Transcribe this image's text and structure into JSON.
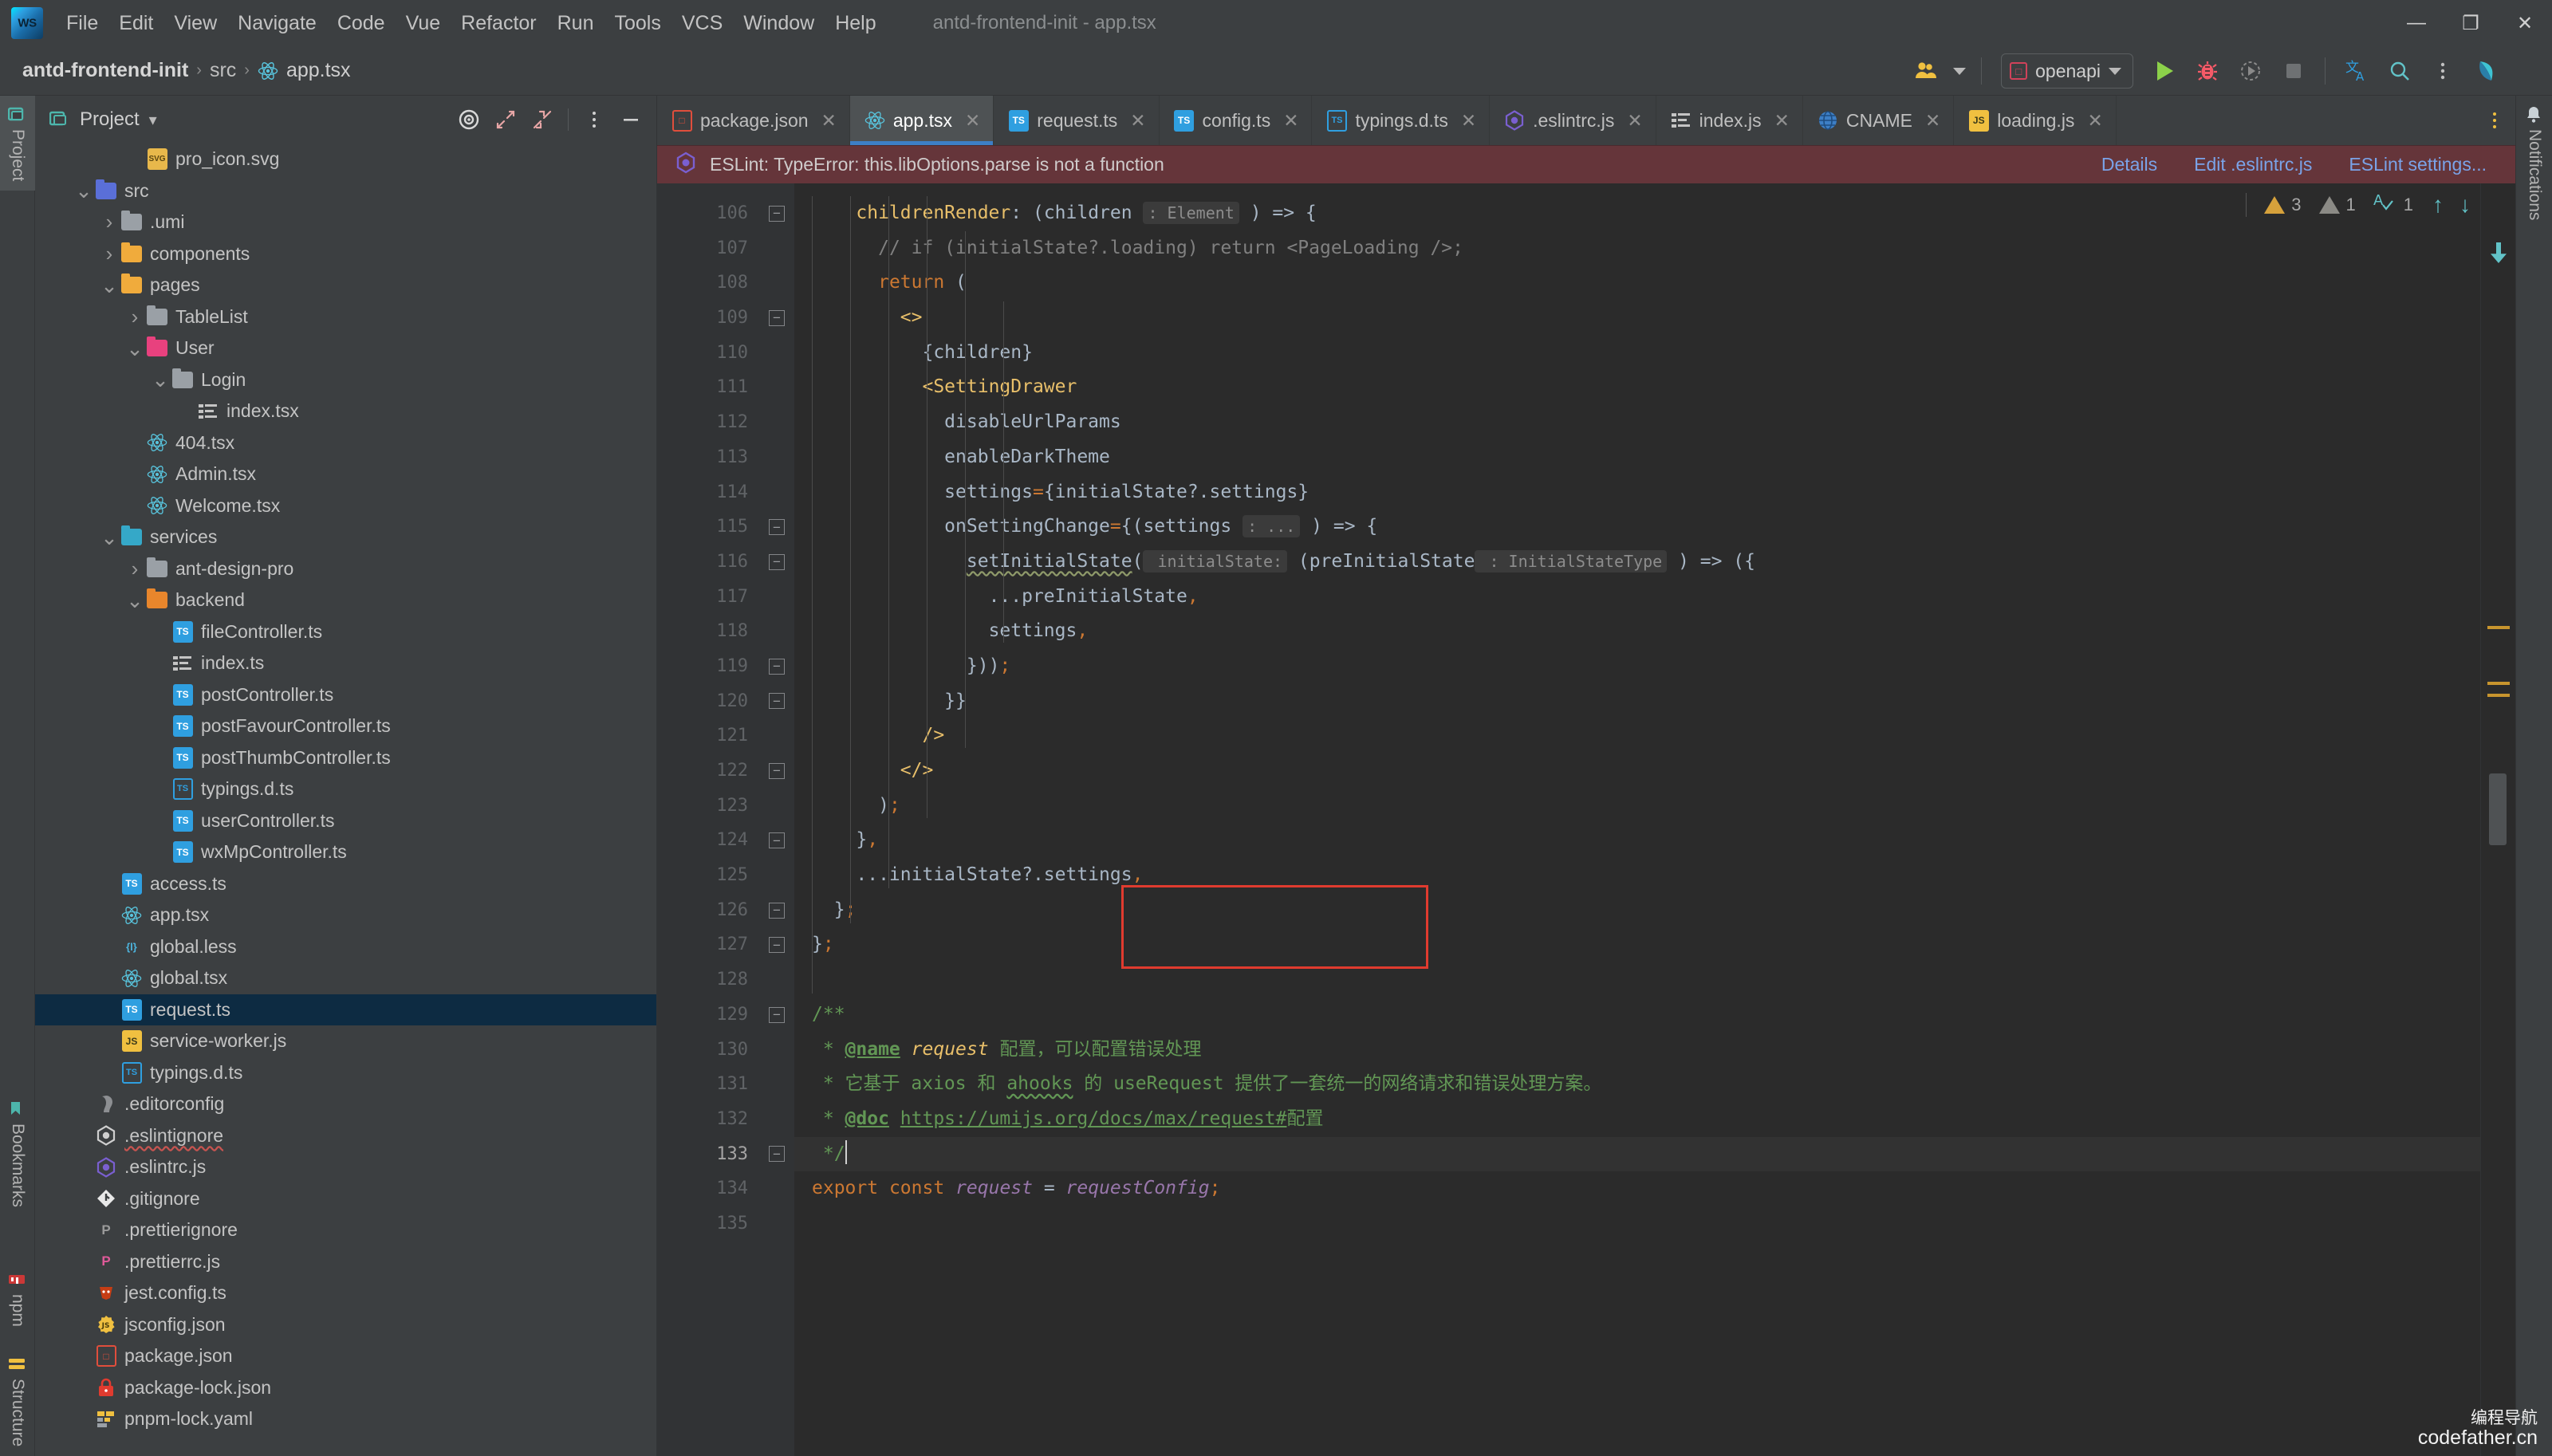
{
  "window": {
    "title": "antd-frontend-init - app.tsx",
    "controls": {
      "minimize": "—",
      "maximize": "❐",
      "close": "✕"
    }
  },
  "menubar": {
    "logo_text": "WS",
    "items": [
      "File",
      "Edit",
      "View",
      "Navigate",
      "Code",
      "Vue",
      "Refactor",
      "Run",
      "Tools",
      "VCS",
      "Window",
      "Help"
    ]
  },
  "navbar": {
    "breadcrumb": {
      "root": "antd-frontend-init",
      "sep": "›",
      "segments": [
        "src"
      ],
      "file": "app.tsx"
    },
    "run_config": {
      "label": "openapi",
      "icon": "module-icon"
    },
    "actions": [
      {
        "name": "collaborate-icon",
        "glyph": "👥"
      },
      {
        "name": "run-icon",
        "glyph": "▶"
      },
      {
        "name": "debug-icon",
        "glyph": "🐞"
      },
      {
        "name": "run-with-coverage-icon",
        "glyph": "◔"
      },
      {
        "name": "stop-icon",
        "glyph": "■"
      },
      {
        "name": "translate-icon",
        "glyph": "文A"
      },
      {
        "name": "search-everywhere-icon",
        "glyph": "🔍"
      },
      {
        "name": "more-options-icon",
        "glyph": "⋮"
      },
      {
        "name": "ide-assistant-icon",
        "glyph": "◗"
      }
    ]
  },
  "left_strip": {
    "tools": [
      {
        "label": "Project",
        "icon": "project-icon",
        "active": true
      },
      {
        "label": "Bookmarks",
        "icon": "bookmarks-icon",
        "active": false
      },
      {
        "label": "npm",
        "icon": "npm-icon",
        "active": false
      },
      {
        "label": "Structure",
        "icon": "structure-icon",
        "active": false
      }
    ]
  },
  "right_strip": {
    "tools": [
      {
        "label": "Notifications",
        "icon": "bell-icon"
      }
    ]
  },
  "project_panel": {
    "title": "Project",
    "title_icon": "project-folder-icon",
    "header_actions": [
      {
        "name": "scroll-from-source-icon",
        "glyph": "◎"
      },
      {
        "name": "expand-all-icon",
        "glyph": "⤡"
      },
      {
        "name": "collapse-all-icon",
        "glyph": "⤢"
      },
      {
        "name": "options-menu-icon",
        "glyph": "⋮"
      },
      {
        "name": "hide-panel-icon",
        "glyph": "—"
      }
    ],
    "tree": [
      {
        "label": "pro_icon.svg",
        "indent": 3,
        "tw": "",
        "icon": "svg",
        "selected": false
      },
      {
        "label": "src",
        "indent": 1,
        "tw": "v",
        "icon": "f-blue",
        "selected": false
      },
      {
        "label": ".umi",
        "indent": 2,
        "tw": ">",
        "icon": "f-grey",
        "selected": false
      },
      {
        "label": "components",
        "indent": 2,
        "tw": ">",
        "icon": "f-yellow",
        "selected": false
      },
      {
        "label": "pages",
        "indent": 2,
        "tw": "v",
        "icon": "f-yellow",
        "selected": false
      },
      {
        "label": "TableList",
        "indent": 3,
        "tw": ">",
        "icon": "f-grey",
        "selected": false
      },
      {
        "label": "User",
        "indent": 3,
        "tw": "v",
        "icon": "f-pink",
        "selected": false
      },
      {
        "label": "Login",
        "indent": 4,
        "tw": "v",
        "icon": "f-grey",
        "selected": false
      },
      {
        "label": "index.tsx",
        "indent": 5,
        "tw": "",
        "icon": "list",
        "selected": false
      },
      {
        "label": "404.tsx",
        "indent": 3,
        "tw": "",
        "icon": "react",
        "selected": false
      },
      {
        "label": "Admin.tsx",
        "indent": 3,
        "tw": "",
        "icon": "react",
        "selected": false
      },
      {
        "label": "Welcome.tsx",
        "indent": 3,
        "tw": "",
        "icon": "react",
        "selected": false
      },
      {
        "label": "services",
        "indent": 2,
        "tw": "v",
        "icon": "f-cyan",
        "selected": false
      },
      {
        "label": "ant-design-pro",
        "indent": 3,
        "tw": ">",
        "icon": "f-grey",
        "selected": false
      },
      {
        "label": "backend",
        "indent": 3,
        "tw": "v",
        "icon": "f-orange",
        "selected": false
      },
      {
        "label": "fileController.ts",
        "indent": 4,
        "tw": "",
        "icon": "ts",
        "selected": false
      },
      {
        "label": "index.ts",
        "indent": 4,
        "tw": "",
        "icon": "list",
        "selected": false
      },
      {
        "label": "postController.ts",
        "indent": 4,
        "tw": "",
        "icon": "ts",
        "selected": false
      },
      {
        "label": "postFavourController.ts",
        "indent": 4,
        "tw": "",
        "icon": "ts",
        "selected": false
      },
      {
        "label": "postThumbController.ts",
        "indent": 4,
        "tw": "",
        "icon": "ts",
        "selected": false
      },
      {
        "label": "typings.d.ts",
        "indent": 4,
        "tw": "",
        "icon": "tsout",
        "selected": false
      },
      {
        "label": "userController.ts",
        "indent": 4,
        "tw": "",
        "icon": "ts",
        "selected": false
      },
      {
        "label": "wxMpController.ts",
        "indent": 4,
        "tw": "",
        "icon": "ts",
        "selected": false
      },
      {
        "label": "access.ts",
        "indent": 2,
        "tw": "",
        "icon": "ts",
        "selected": false
      },
      {
        "label": "app.tsx",
        "indent": 2,
        "tw": "",
        "icon": "react",
        "selected": false
      },
      {
        "label": "global.less",
        "indent": 2,
        "tw": "",
        "icon": "less",
        "selected": false
      },
      {
        "label": "global.tsx",
        "indent": 2,
        "tw": "",
        "icon": "react",
        "selected": false
      },
      {
        "label": "request.ts",
        "indent": 2,
        "tw": "",
        "icon": "ts",
        "selected": true
      },
      {
        "label": "service-worker.js",
        "indent": 2,
        "tw": "",
        "icon": "js",
        "selected": false
      },
      {
        "label": "typings.d.ts",
        "indent": 2,
        "tw": "",
        "icon": "tsout",
        "selected": false
      },
      {
        "label": ".editorconfig",
        "indent": 1,
        "tw": "",
        "icon": "editorcfg",
        "selected": false
      },
      {
        "label": ".eslintignore",
        "indent": 1,
        "tw": "",
        "icon": "eslint-g",
        "selected": false,
        "wavy": true
      },
      {
        "label": ".eslintrc.js",
        "indent": 1,
        "tw": "",
        "icon": "eslint-p",
        "selected": false
      },
      {
        "label": ".gitignore",
        "indent": 1,
        "tw": "",
        "icon": "git",
        "selected": false
      },
      {
        "label": ".prettierignore",
        "indent": 1,
        "tw": "",
        "icon": "prett-g",
        "selected": false
      },
      {
        "label": ".prettierrc.js",
        "indent": 1,
        "tw": "",
        "icon": "prett-p",
        "selected": false
      },
      {
        "label": "jest.config.ts",
        "indent": 1,
        "tw": "",
        "icon": "jest",
        "selected": false
      },
      {
        "label": "jsconfig.json",
        "indent": 1,
        "tw": "",
        "icon": "jsgear",
        "selected": false
      },
      {
        "label": "package.json",
        "indent": 1,
        "tw": "",
        "icon": "json",
        "selected": false
      },
      {
        "label": "package-lock.json",
        "indent": 1,
        "tw": "",
        "icon": "lock",
        "selected": false
      },
      {
        "label": "pnpm-lock.yaml",
        "indent": 1,
        "tw": "",
        "icon": "yaml",
        "selected": false
      }
    ]
  },
  "editor": {
    "tabs": [
      {
        "label": "package.json",
        "icon": "json",
        "active": false
      },
      {
        "label": "app.tsx",
        "icon": "react",
        "active": true
      },
      {
        "label": "request.ts",
        "icon": "ts",
        "active": false
      },
      {
        "label": "config.ts",
        "icon": "ts",
        "active": false
      },
      {
        "label": "typings.d.ts",
        "icon": "tsout",
        "active": false
      },
      {
        "label": ".eslintrc.js",
        "icon": "eslint",
        "active": false
      },
      {
        "label": "index.js",
        "icon": "list",
        "active": false
      },
      {
        "label": "CNAME",
        "icon": "globe",
        "active": false
      },
      {
        "label": "loading.js",
        "icon": "js",
        "active": false
      }
    ],
    "tabs_more_icon": "tabs-more-icon",
    "eslint_banner": {
      "icon": "eslint-icon",
      "message": "ESLint: TypeError: this.libOptions.parse is not a function",
      "links": [
        "Details",
        "Edit .eslintrc.js",
        "ESLint settings..."
      ]
    },
    "inspections": {
      "warning_count": "3",
      "weak_warning_count": "1",
      "typo_count": "1",
      "prev_icon": "arrow-up-icon",
      "next_icon": "arrow-down-icon"
    },
    "first_line_number": 106,
    "lines": [
      {
        "n": 106,
        "fold": "minus",
        "indent": 2,
        "tokens": [
          {
            "t": "childrenRender",
            "c": "c-attr"
          },
          {
            "t": ": ",
            "c": "c-default"
          },
          {
            "t": "(",
            "c": "c-default"
          },
          {
            "t": "children",
            "c": "c-default"
          },
          {
            "t": " ",
            "c": "c-default"
          },
          {
            "t": ": Element",
            "c": "c-hint"
          },
          {
            "t": " ) => {",
            "c": "c-default"
          }
        ]
      },
      {
        "n": 107,
        "fold": "",
        "indent": 3,
        "tokens": [
          {
            "t": "// if (initialState?.loading) return <PageLoading />;",
            "c": "c-comment"
          }
        ]
      },
      {
        "n": 108,
        "fold": "",
        "indent": 3,
        "tokens": [
          {
            "t": "return",
            "c": "c-keyword"
          },
          {
            "t": " (",
            "c": "c-default"
          }
        ]
      },
      {
        "n": 109,
        "fold": "minus",
        "indent": 4,
        "tokens": [
          {
            "t": "<>",
            "c": "c-tag"
          }
        ]
      },
      {
        "n": 110,
        "fold": "",
        "indent": 5,
        "tokens": [
          {
            "t": "{children}",
            "c": "c-default"
          }
        ]
      },
      {
        "n": 111,
        "fold": "",
        "indent": 5,
        "tokens": [
          {
            "t": "<SettingDrawer",
            "c": "c-tag"
          }
        ]
      },
      {
        "n": 112,
        "fold": "",
        "indent": 6,
        "tokens": [
          {
            "t": "disableUrlParams",
            "c": "c-default"
          }
        ]
      },
      {
        "n": 113,
        "fold": "",
        "indent": 6,
        "tokens": [
          {
            "t": "enableDarkTheme",
            "c": "c-default"
          }
        ]
      },
      {
        "n": 114,
        "fold": "",
        "indent": 6,
        "tokens": [
          {
            "t": "settings",
            "c": "c-default"
          },
          {
            "t": "=",
            "c": "c-punct"
          },
          {
            "t": "{initialState?.settings}",
            "c": "c-default"
          }
        ]
      },
      {
        "n": 115,
        "fold": "minus",
        "indent": 6,
        "tokens": [
          {
            "t": "onSettingChange",
            "c": "c-default"
          },
          {
            "t": "=",
            "c": "c-punct"
          },
          {
            "t": "{(settings",
            "c": "c-default"
          },
          {
            "t": " ",
            "c": "c-default"
          },
          {
            "t": ": ...",
            "c": "c-hint"
          },
          {
            "t": " ) => {",
            "c": "c-default"
          }
        ]
      },
      {
        "n": 116,
        "fold": "minus",
        "indent": 7,
        "tokens": [
          {
            "t": "setInitialState",
            "c": "c-default wavy-gray"
          },
          {
            "t": "(",
            "c": "c-default"
          },
          {
            "t": " initialState:",
            "c": "c-hint"
          },
          {
            "t": " (preInitialState",
            "c": "c-default"
          },
          {
            "t": " : InitialStateType",
            "c": "c-hint"
          },
          {
            "t": " ) => ({",
            "c": "c-default"
          }
        ]
      },
      {
        "n": 117,
        "fold": "",
        "indent": 8,
        "tokens": [
          {
            "t": "...preInitialState",
            "c": "c-default"
          },
          {
            "t": ",",
            "c": "c-punct"
          }
        ]
      },
      {
        "n": 118,
        "fold": "",
        "indent": 8,
        "tokens": [
          {
            "t": "settings",
            "c": "c-default"
          },
          {
            "t": ",",
            "c": "c-punct"
          }
        ]
      },
      {
        "n": 119,
        "fold": "plus",
        "indent": 7,
        "tokens": [
          {
            "t": "}))",
            "c": "c-default"
          },
          {
            "t": ";",
            "c": "c-punct"
          }
        ]
      },
      {
        "n": 120,
        "fold": "plus",
        "indent": 6,
        "tokens": [
          {
            "t": "}}",
            "c": "c-default"
          }
        ]
      },
      {
        "n": 121,
        "fold": "",
        "indent": 5,
        "tokens": [
          {
            "t": "/>",
            "c": "c-tag"
          }
        ]
      },
      {
        "n": 122,
        "fold": "plus",
        "indent": 4,
        "tokens": [
          {
            "t": "</>",
            "c": "c-tag"
          }
        ]
      },
      {
        "n": 123,
        "fold": "",
        "indent": 3,
        "tokens": [
          {
            "t": ")",
            "c": "c-default"
          },
          {
            "t": ";",
            "c": "c-punct"
          }
        ]
      },
      {
        "n": 124,
        "fold": "plus",
        "indent": 2,
        "tokens": [
          {
            "t": "}",
            "c": "c-default"
          },
          {
            "t": ",",
            "c": "c-punct"
          }
        ]
      },
      {
        "n": 125,
        "fold": "",
        "indent": 2,
        "tokens": [
          {
            "t": "...initialState?.settings",
            "c": "c-default"
          },
          {
            "t": ",",
            "c": "c-punct"
          }
        ]
      },
      {
        "n": 126,
        "fold": "plus",
        "indent": 1,
        "tokens": [
          {
            "t": "}",
            "c": "c-default"
          },
          {
            "t": ";",
            "c": "c-punct"
          }
        ]
      },
      {
        "n": 127,
        "fold": "plus",
        "indent": 0,
        "tokens": [
          {
            "t": "}",
            "c": "c-default"
          },
          {
            "t": ";",
            "c": "c-punct"
          }
        ]
      },
      {
        "n": 128,
        "fold": "",
        "indent": 0,
        "tokens": []
      },
      {
        "n": 129,
        "fold": "minus",
        "indent": 0,
        "tokens": [
          {
            "t": "/**",
            "c": "c-doc"
          }
        ]
      },
      {
        "n": 130,
        "fold": "",
        "indent": 0,
        "tokens": [
          {
            "t": " * ",
            "c": "c-doc"
          },
          {
            "t": "@name",
            "c": "c-doctag"
          },
          {
            "t": " ",
            "c": "c-doc"
          },
          {
            "t": "request",
            "c": "c-attr c-italic"
          },
          {
            "t": " 配置，可以配置错误处理",
            "c": "c-doc"
          }
        ]
      },
      {
        "n": 131,
        "fold": "",
        "indent": 0,
        "tokens": [
          {
            "t": " * 它基于 axios 和 ",
            "c": "c-doc"
          },
          {
            "t": "ahooks",
            "c": "c-doc wavy-green"
          },
          {
            "t": " 的 useRequest 提供了一套统一的网络请求和错误处理方案。",
            "c": "c-doc"
          }
        ]
      },
      {
        "n": 132,
        "fold": "",
        "indent": 0,
        "tokens": [
          {
            "t": " * ",
            "c": "c-doc"
          },
          {
            "t": "@doc",
            "c": "c-doctag"
          },
          {
            "t": " ",
            "c": "c-doc"
          },
          {
            "t": "https://umijs.org/docs/max/request#",
            "c": "c-link"
          },
          {
            "t": "配置",
            "c": "c-doc"
          }
        ]
      },
      {
        "n": 133,
        "fold": "plus",
        "indent": 0,
        "caret": true,
        "tokens": [
          {
            "t": " */",
            "c": "c-doc"
          }
        ]
      },
      {
        "n": 134,
        "fold": "",
        "indent": 0,
        "tokens": [
          {
            "t": "export",
            "c": "c-keyword"
          },
          {
            "t": " ",
            "c": "c-default"
          },
          {
            "t": "const",
            "c": "c-keyword"
          },
          {
            "t": " ",
            "c": "c-default"
          },
          {
            "t": "request",
            "c": "c-purple c-italic"
          },
          {
            "t": " = ",
            "c": "c-default"
          },
          {
            "t": "requestConfig",
            "c": "c-purple c-italic"
          },
          {
            "t": ";",
            "c": "c-punct"
          }
        ]
      },
      {
        "n": 135,
        "fold": "",
        "indent": 0,
        "tokens": []
      }
    ],
    "annotation_box": {
      "name": "red-highlight-box"
    }
  },
  "watermark": {
    "line1": "编程导航",
    "line2": "codefather.cn"
  }
}
